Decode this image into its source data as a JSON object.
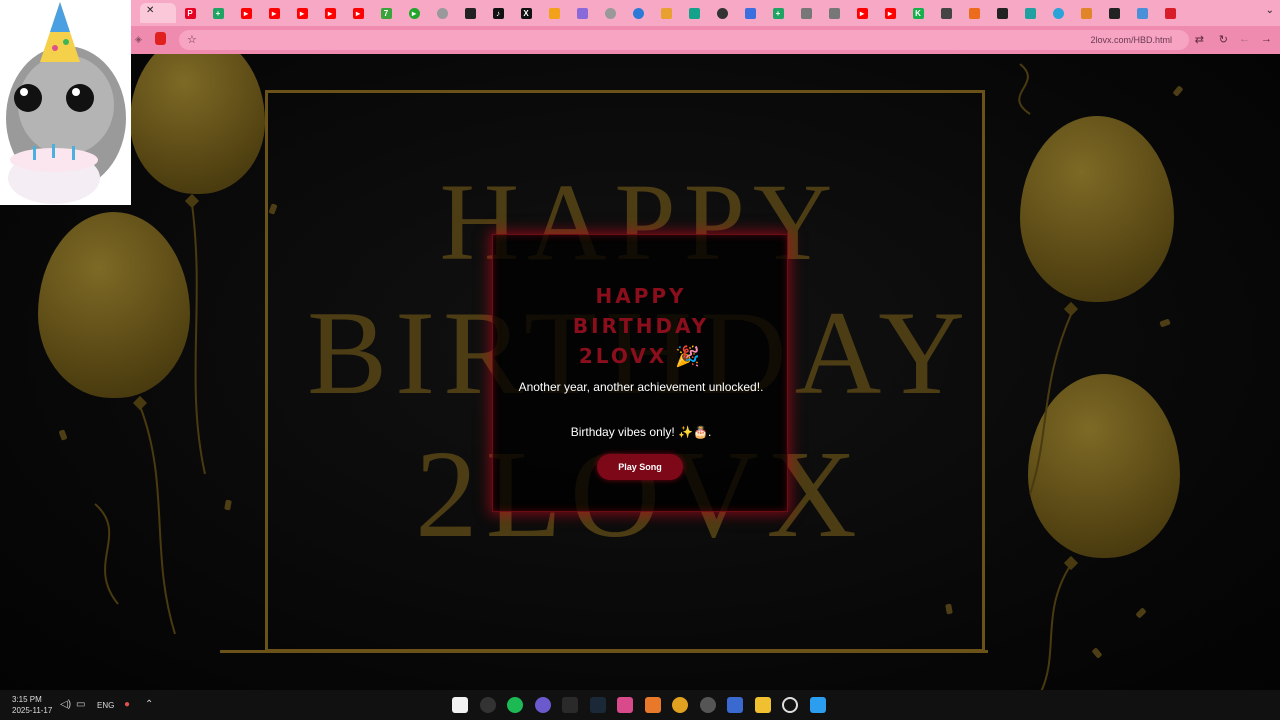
{
  "browser": {
    "url": "2lovx.com/HBD.html",
    "tab_close_glyph": "✕"
  },
  "page": {
    "background_word1": "HAPPY",
    "background_word2": "BIRTHDAY",
    "background_word3": "2LOVX",
    "card": {
      "title_line1": "HAPPY",
      "title_line2": "BIRTHDAY",
      "title_line3": "2LOVX",
      "title_emoji": "🎉",
      "message1": "Another year, another achievement unlocked!.",
      "message2": "Birthday vibes only! ✨🎂.",
      "play_button": "Play Song"
    }
  },
  "taskbar": {
    "time": "3:15 PM",
    "date": "2025-11-17",
    "language": "ENG"
  },
  "colors": {
    "tabbar": "#f7a8c4",
    "addressbar": "#f08bb0",
    "gold": "#6a5218",
    "card_glow": "#c80a1e",
    "button": "#7d0818"
  }
}
